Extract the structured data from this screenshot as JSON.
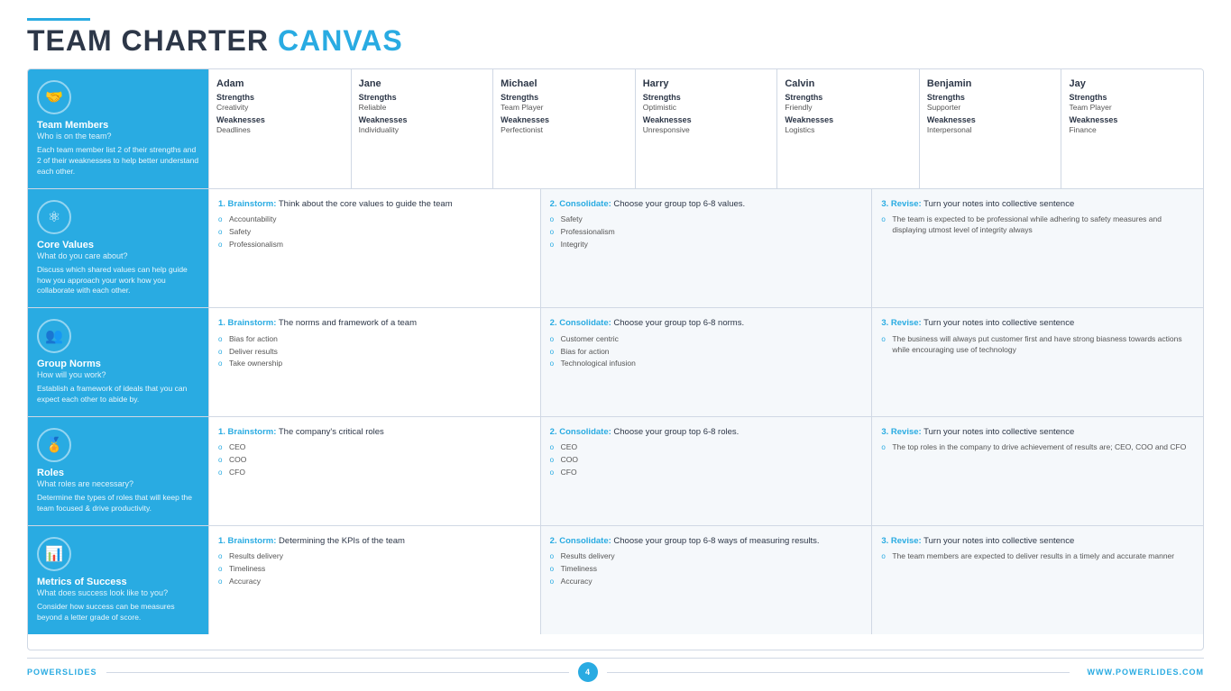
{
  "header": {
    "line": true,
    "title_dark": "TEAM CHARTER",
    "title_blue": "CANVAS"
  },
  "footer": {
    "left": "POWERSLIDES",
    "page": "4",
    "right": "WWW.POWERLIDES.COM"
  },
  "sections": [
    {
      "id": "team-members",
      "icon": "🤝",
      "title": "Team Members",
      "subtitle": "Who is on the team?",
      "desc": "Each team member list 2 of their strengths and 2 of their weaknesses to help better understand each other."
    },
    {
      "id": "core-values",
      "icon": "⚛",
      "title": "Core Values",
      "subtitle": "What do you care about?",
      "desc": "Discuss which shared values can help guide how you approach your work how you collaborate with each other."
    },
    {
      "id": "group-norms",
      "icon": "👥",
      "title": "Group Norms",
      "subtitle": "How will you work?",
      "desc": "Establish a framework of ideals that you can expect each other to abide by."
    },
    {
      "id": "roles",
      "icon": "🏅",
      "title": "Roles",
      "subtitle": "What roles are necessary?",
      "desc": "Determine the types of roles that will keep the team focused & drive productivity."
    },
    {
      "id": "metrics",
      "icon": "📊",
      "title": "Metrics of Success",
      "subtitle": "What does success look like to you?",
      "desc": "Consider how success can be measures beyond a letter grade of score."
    }
  ],
  "members": [
    {
      "name": "Adam",
      "strengths_label": "Strengths",
      "strengths": "Creativity",
      "weaknesses_label": "Weaknesses",
      "weaknesses": "Deadlines"
    },
    {
      "name": "Jane",
      "strengths_label": "Strengths",
      "strengths": "Reliable",
      "weaknesses_label": "Weaknesses",
      "weaknesses": "Individuality"
    },
    {
      "name": "Michael",
      "strengths_label": "Strengths",
      "strengths": "Team Player",
      "weaknesses_label": "Weaknesses",
      "weaknesses": "Perfectionist"
    },
    {
      "name": "Harry",
      "strengths_label": "Strengths",
      "strengths": "Optimistic",
      "weaknesses_label": "Weaknesses",
      "weaknesses": "Unresponsive"
    },
    {
      "name": "Calvin",
      "strengths_label": "Strengths",
      "strengths": "Friendly",
      "weaknesses_label": "Weaknesses",
      "weaknesses": "Logistics"
    },
    {
      "name": "Benjamin",
      "strengths_label": "Strengths",
      "strengths": "Supporter",
      "weaknesses_label": "Weaknesses",
      "weaknesses": "Interpersonal"
    },
    {
      "name": "Jay",
      "strengths_label": "Strengths",
      "strengths": "Team Player",
      "weaknesses_label": "Weaknesses",
      "weaknesses": "Finance"
    }
  ],
  "core_values": {
    "step1": {
      "bold": "1. Brainstorm:",
      "text": " Think about the core values to guide the team",
      "bullets": [
        "Accountability",
        "Safety",
        "Professionalism"
      ]
    },
    "step2": {
      "bold": "2. Consolidate:",
      "text": " Choose your group top 6-8 values.",
      "bullets": [
        "Safety",
        "Professionalism",
        "Integrity"
      ]
    },
    "step3": {
      "bold": "3. Revise:",
      "text": " Turn your notes into collective sentence",
      "bullets": [
        "The team is expected to be professional while adhering to safety measures and displaying utmost level of integrity always"
      ]
    }
  },
  "group_norms": {
    "step1": {
      "bold": "1. Brainstorm:",
      "text": " The norms and framework of a team",
      "bullets": [
        "Bias for action",
        "Deliver results",
        "Take ownership"
      ]
    },
    "step2": {
      "bold": "2. Consolidate:",
      "text": " Choose your group top 6-8 norms.",
      "bullets": [
        "Customer centric",
        "Bias for action",
        "Technological infusion"
      ]
    },
    "step3": {
      "bold": "3. Revise:",
      "text": " Turn your notes into collective sentence",
      "bullets": [
        "The business will always put customer first and have strong biasness towards actions while encouraging use of technology"
      ]
    }
  },
  "roles": {
    "step1": {
      "bold": "1. Brainstorm:",
      "text": " The company's critical roles",
      "bullets": [
        "CEO",
        "COO",
        "CFO"
      ]
    },
    "step2": {
      "bold": "2. Consolidate:",
      "text": " Choose your group top 6-8 roles.",
      "bullets": [
        "CEO",
        "COO",
        "CFO"
      ]
    },
    "step3": {
      "bold": "3. Revise:",
      "text": " Turn your notes into collective sentence",
      "bullets": [
        "The top roles in the company to drive achievement of results are; CEO, COO and CFO"
      ]
    }
  },
  "metrics": {
    "step1": {
      "bold": "1. Brainstorm:",
      "text": " Determining the KPIs of the team",
      "bullets": [
        "Results delivery",
        "Timeliness",
        "Accuracy"
      ]
    },
    "step2": {
      "bold": "2. Consolidate:",
      "text": " Choose your group top 6-8 ways of measuring results.",
      "bullets": [
        "Results delivery",
        "Timeliness",
        "Accuracy"
      ]
    },
    "step3": {
      "bold": "3. Revise:",
      "text": " Turn your notes into collective sentence",
      "bullets": [
        "The team members are expected to deliver results in a timely and accurate manner"
      ]
    }
  }
}
